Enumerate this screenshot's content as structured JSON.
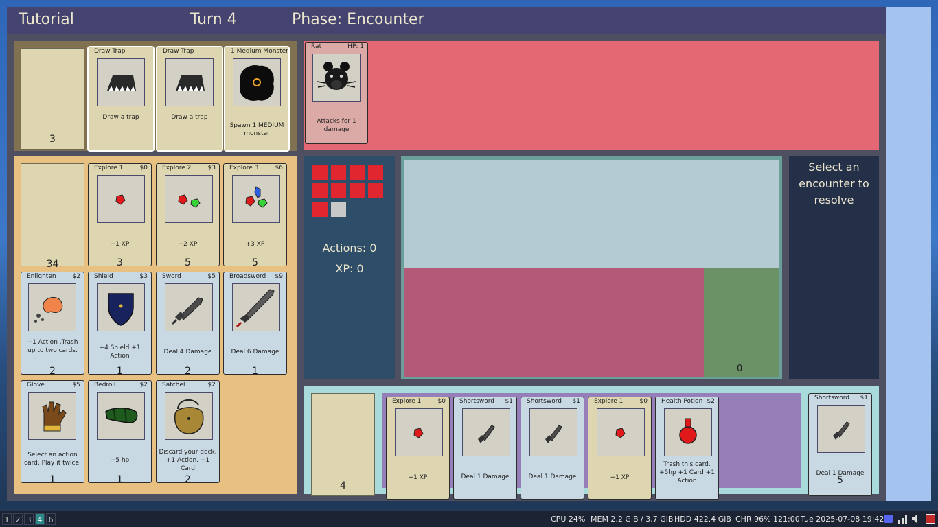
{
  "header": {
    "title": "Tutorial",
    "turn": "Turn 4",
    "phase": "Phase: Encounter"
  },
  "encounter_row": {
    "deck_count": "3",
    "cards": [
      {
        "title": "Draw Trap",
        "desc": "Draw a trap",
        "art": "trap-icon"
      },
      {
        "title": "Draw Trap",
        "desc": "Draw a trap",
        "art": "trap-icon"
      },
      {
        "title": "1 Medium Monster",
        "desc": "Spawn 1 MEDIUM monster",
        "art": "monster-blob-icon"
      }
    ]
  },
  "monster": {
    "name": "Rat",
    "hp": "HP: 1",
    "desc": "Attacks for 1 damage",
    "art": "rat-icon"
  },
  "market": {
    "deck_count": "34",
    "cards": [
      {
        "title": "Explore 1",
        "cost": "$0",
        "desc": "+1 XP",
        "count": "3",
        "art": "red-gem-icon"
      },
      {
        "title": "Explore 2",
        "cost": "$3",
        "desc": "+2 XP",
        "count": "5",
        "art": "two-gems-icon"
      },
      {
        "title": "Explore 3",
        "cost": "$6",
        "desc": "+3 XP",
        "count": "5",
        "art": "three-gems-icon"
      },
      {
        "title": "Enlighten",
        "cost": "$2",
        "desc": "+1 Action .Trash up to two cards.",
        "count": "2",
        "art": "enlighten-icon"
      },
      {
        "title": "Shield",
        "cost": "$3",
        "desc": "+4 Shield +1 Action",
        "count": "1",
        "art": "shield-icon"
      },
      {
        "title": "Sword",
        "cost": "$5",
        "desc": "Deal 4 Damage",
        "count": "2",
        "art": "sword-icon"
      },
      {
        "title": "Broadsword",
        "cost": "$9",
        "desc": "Deal 6 Damage",
        "count": "1",
        "art": "broadsword-icon"
      },
      {
        "title": "Glove",
        "cost": "$5",
        "desc": "Select an action card. Play it twice.",
        "count": "1",
        "art": "glove-icon"
      },
      {
        "title": "Bedroll",
        "cost": "$2",
        "desc": "+5 hp",
        "count": "1",
        "art": "bedroll-icon"
      },
      {
        "title": "Satchel",
        "cost": "$2",
        "desc": "Discard your deck. +1 Action. +1 Card",
        "count": "2",
        "art": "satchel-icon"
      }
    ]
  },
  "status": {
    "actions": "Actions: 0",
    "xp": "XP: 0",
    "hp_filled": 9,
    "hp_total": 10,
    "hp_color": "#e0262f"
  },
  "board": {
    "counter": "0"
  },
  "prompt": "Select an encounter to resolve",
  "hand": {
    "draw_count": "4",
    "cards": [
      {
        "title": "Explore 1",
        "cost": "$0",
        "desc": "+1 XP",
        "art": "red-gem-icon",
        "type": "tan"
      },
      {
        "title": "Shortsword",
        "cost": "$1",
        "desc": "Deal 1 Damage",
        "art": "shortsword-icon",
        "type": "blue"
      },
      {
        "title": "Shortsword",
        "cost": "$1",
        "desc": "Deal 1 Damage",
        "art": "shortsword-icon",
        "type": "blue"
      },
      {
        "title": "Explore 1",
        "cost": "$0",
        "desc": "+1 XP",
        "art": "red-gem-icon",
        "type": "tan"
      },
      {
        "title": "Health Potion",
        "cost": "$2",
        "desc": "Trash this card. +5hp +1 Card +1 Action",
        "art": "potion-icon",
        "type": "blue"
      }
    ],
    "discard": {
      "title": "Shortsword",
      "cost": "$1",
      "desc": "Deal 1 Damage",
      "count": "5",
      "art": "shortsword-icon"
    }
  },
  "taskbar": {
    "workspaces": [
      "1",
      "2",
      "3",
      "4",
      "6"
    ],
    "active_workspace": "4",
    "cpu": "CPU 24%",
    "mem": "MEM 2.2 GiB / 3.7 GiB",
    "hdd": "HDD 422.4 GiB",
    "chr": "CHR 96% 121:00",
    "date": "Tue  2025-07-08  19:42"
  }
}
